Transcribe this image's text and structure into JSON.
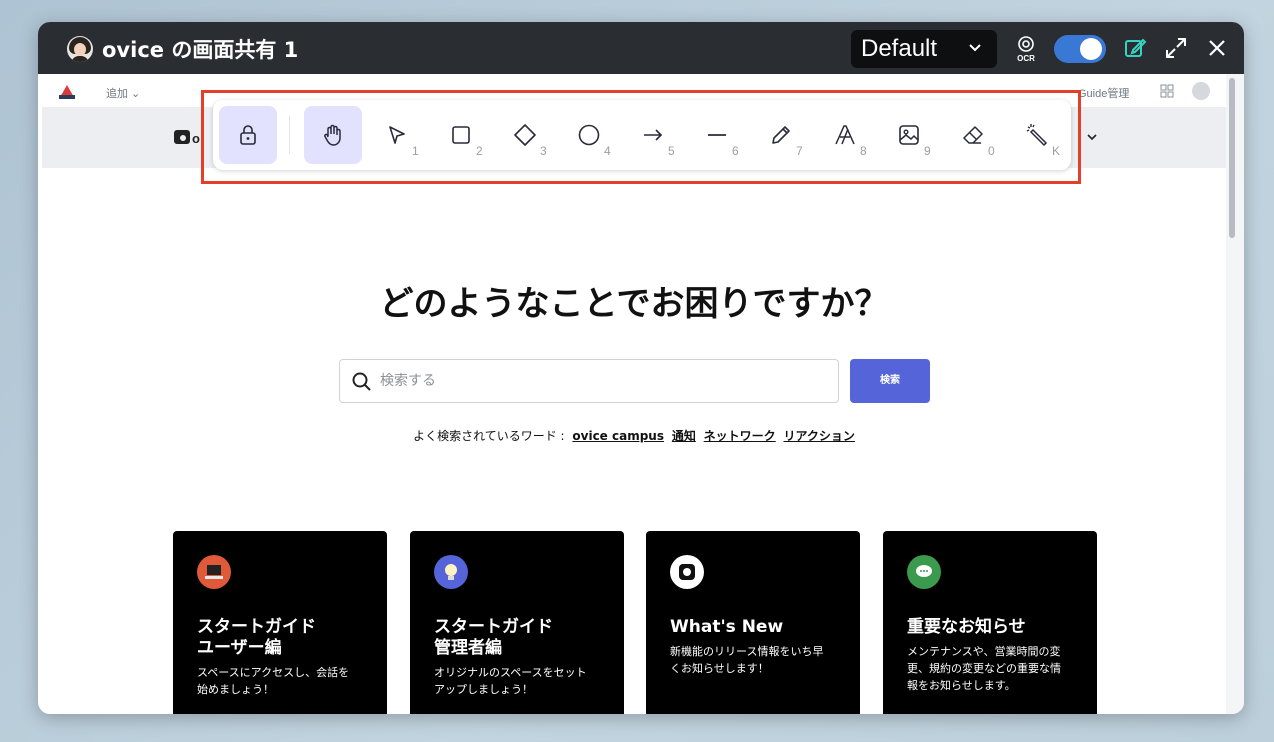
{
  "window": {
    "title": "ovice の画面共有 1",
    "preset": "Default",
    "ocr_label": "OCR",
    "toggle_on": true
  },
  "toolbar": {
    "tools": [
      {
        "name": "lock",
        "key": "",
        "active": true
      },
      {
        "name": "hand",
        "key": "",
        "active": true
      },
      {
        "name": "select",
        "key": "1"
      },
      {
        "name": "rectangle",
        "key": "2"
      },
      {
        "name": "diamond",
        "key": "3"
      },
      {
        "name": "ellipse",
        "key": "4"
      },
      {
        "name": "arrow",
        "key": "5"
      },
      {
        "name": "line",
        "key": "6"
      },
      {
        "name": "draw",
        "key": "7"
      },
      {
        "name": "text",
        "key": "8"
      },
      {
        "name": "image",
        "key": "9"
      },
      {
        "name": "eraser",
        "key": "0"
      },
      {
        "name": "laser",
        "key": "K"
      }
    ],
    "highlight_color": "#e43f2b",
    "active_color": "#e2e2ff"
  },
  "admin_bar": {
    "add_label": "追加",
    "guide_label": "Guide管理"
  },
  "page": {
    "heading": "どのようなことでお困りですか？",
    "search_placeholder": "検索する",
    "search_button": "検索",
    "popular_label": "よく検索されているワード :",
    "popular_words": [
      "ovice campus",
      "通知",
      "ネットワーク",
      "リアクション"
    ],
    "button_color": "#5564d8"
  },
  "cards": [
    {
      "title_line1": "スタートガイド",
      "title_line2": "ユーザー編",
      "desc_line1": "スペースにアクセスし、会話を",
      "desc_line2": "始めましょう！",
      "icon": "laptop-icon",
      "icon_color": "#e05a3a"
    },
    {
      "title_line1": "スタートガイド",
      "title_line2": "管理者編",
      "desc_line1": "オリジナルのスペースをセット",
      "desc_line2": "アップしましょう！",
      "icon": "lightbulb-icon",
      "icon_color": "#5564d8"
    },
    {
      "title_line1": "What's New",
      "title_line2": "",
      "desc_line1": "新機能のリリース情報をいち早",
      "desc_line2": "くお知らせします！",
      "icon": "ovice-logo-icon",
      "icon_color": "#ffffff"
    },
    {
      "title_line1": "重要なお知らせ",
      "title_line2": "",
      "desc_line1": "メンテナンスや、営業時間の変",
      "desc_line2": "更、規約の変更などの重要な情",
      "desc_line3": "報をお知らせします。",
      "icon": "chat-bubble-icon",
      "icon_color": "#3c9a4e"
    }
  ]
}
